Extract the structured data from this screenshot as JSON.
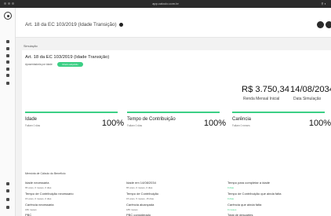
{
  "window": {
    "url": "app.calculo.com.br",
    "right": "⚲ ◐"
  },
  "header": {
    "title": "Art. 18 da EC 103/2019 (Idade Transição)"
  },
  "simulation": {
    "section_label": "Simulação",
    "title": "Art. 18 da EC 103/2019 (Idade Transição)",
    "sub_label": "Aposentadoria por idade",
    "pill": "Direito adquirido",
    "renda": "R$ 3.750,34",
    "renda_label": "Renda Mensal Inicial",
    "data": "14/08/2034",
    "data_label": "Data Simulação"
  },
  "metrics": [
    {
      "title": "Idade",
      "sub": "Faltam 0 dias",
      "pct": "100%",
      "fill": 1.0
    },
    {
      "title": "Tempo de Contribuição",
      "sub": "Faltam 0 dias",
      "pct": "100%",
      "fill": 1.0
    },
    {
      "title": "Carência",
      "sub": "Faltam 0 meses",
      "pct": "100%",
      "fill": 1.0
    }
  ],
  "memoria": {
    "title": "Memória de Cálculo do Benefício",
    "items": [
      {
        "label": "Idade necessária",
        "value": "65 anos, 0 meses, 0 dias",
        "green": false
      },
      {
        "label": "Idade em 14/08/2034",
        "value": "65 anos, 0 meses, 0 dias",
        "green": false
      },
      {
        "label": "Tempo para completar a idade",
        "value": "0 dias",
        "green": true
      },
      {
        "label": "Tempo de Contribuição necessário",
        "value": "15 anos, 0 meses, 0 dias",
        "green": false
      },
      {
        "label": "Tempo de Contribuição",
        "value": "15 anos, 5 meses, 15 dias",
        "green": false
      },
      {
        "label": "Tempo de Contribuição que ainda falta",
        "value": "0 dias",
        "green": true
      },
      {
        "label": "Carência necessária",
        "value": "180 meses",
        "green": false
      },
      {
        "label": "Carência alcançada",
        "value": "185 meses",
        "green": false
      },
      {
        "label": "Carência que ainda falta",
        "value": "0 meses",
        "green": true
      },
      {
        "label": "PBC",
        "value": "CTF",
        "green": false
      },
      {
        "label": "PBC considerado",
        "value": "135",
        "green": false
      },
      {
        "label": "Total de descartes",
        "value": "CE",
        "green": false
      }
    ]
  }
}
